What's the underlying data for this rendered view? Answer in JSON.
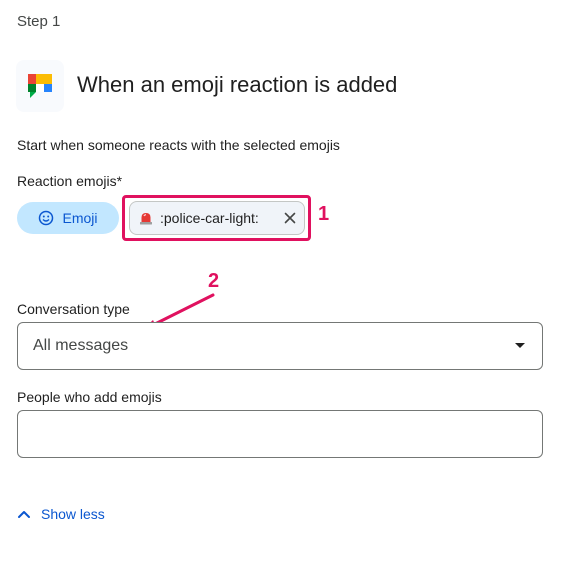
{
  "header": {
    "step_label": "Step 1"
  },
  "trigger": {
    "icon": "google-chat-icon",
    "title": "When an emoji reaction is added",
    "description": "Start when someone reacts with the selected emojis"
  },
  "reaction_emojis": {
    "label": "Reaction emojis*",
    "emoji_button_label": "Emoji",
    "emoji_button_icon": "smiley-icon",
    "chips": [
      {
        "icon": "police-car-light-icon",
        "text": ":police-car-light:",
        "remove_icon": "close-icon"
      }
    ]
  },
  "conversation_type": {
    "label": "Conversation type",
    "value": "All messages"
  },
  "people_who_add_emojis": {
    "label": "People who add emojis",
    "value": ""
  },
  "show_less": {
    "label": "Show less",
    "icon": "chevron-up-icon"
  },
  "annotations": [
    {
      "text": "1"
    },
    {
      "text": "2"
    }
  ],
  "colors": {
    "accent": "#0b57d0",
    "emoji_button_bg": "#c2e7ff",
    "annotation": "#e0115f",
    "chip_bg": "#f0f4f9",
    "field_border": "#747775"
  }
}
